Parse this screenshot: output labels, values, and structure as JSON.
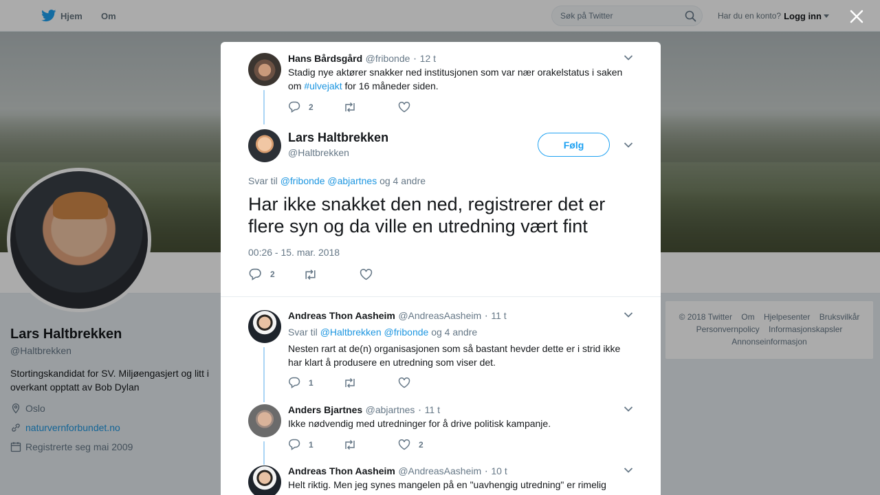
{
  "topbar": {
    "home_label": "Hjem",
    "about_label": "Om",
    "search_placeholder": "Søk på Twitter",
    "account_question": "Har du en konto?",
    "login_label": "Logg inn"
  },
  "profile": {
    "name": "Lars Haltbrekken",
    "handle": "@Haltbrekken",
    "bio": "Stortingskandidat for SV. Miljøengasjert og litt i overkant opptatt av Bob Dylan",
    "location": "Oslo",
    "website": "naturvernforbundet.no",
    "joined": "Registrerte seg mai 2009"
  },
  "footer": {
    "items": [
      "© 2018 Twitter",
      "Om",
      "Hjelpesenter",
      "Bruksvilkår",
      "Personvernpolicy",
      "Informasjonskapsler",
      "Annonseinformasjon"
    ]
  },
  "modal": {
    "parent_tweet": {
      "name": "Hans Bårdsgård",
      "handle": "@fribonde",
      "time": "12 t",
      "text_before": "Stadig nye aktører snakker ned institusjonen som var nær orakelstatus i saken om ",
      "hashtag": "#ulvejakt",
      "text_after": " for 16 måneder siden.",
      "replies": "2"
    },
    "main_tweet": {
      "name": "Lars Haltbrekken",
      "handle": "@Haltbrekken",
      "follow_label": "Følg",
      "reply_prefix": "Svar til",
      "reply_mention_1": "@fribonde",
      "reply_mention_2": "@abjartnes",
      "reply_suffix": "og 4 andre",
      "text": "Har ikke snakket den ned, registrerer det er flere syn og da ville en utredning vært fint",
      "timestamp": "00:26 - 15. mar. 2018",
      "replies": "2"
    },
    "replies": [
      {
        "name": "Andreas Thon Aasheim",
        "handle": "@AndreasAasheim",
        "time": "11 t",
        "reply_prefix": "Svar til",
        "reply_mention_1": "@Haltbrekken",
        "reply_mention_2": "@fribonde",
        "reply_suffix": "og 4 andre",
        "text": "Nesten rart at de(n) organisasjonen som så bastant hevder dette er i strid ikke har klart å produsere en utredning som viser det.",
        "replies": "1"
      },
      {
        "name": "Anders Bjartnes",
        "handle": "@abjartnes",
        "time": "11 t",
        "text": "Ikke nødvendig med utredninger for å drive politisk kampanje.",
        "replies": "1",
        "likes": "2"
      },
      {
        "name": "Andreas Thon Aasheim",
        "handle": "@AndreasAasheim",
        "time": "10 t",
        "text": "Helt riktig. Men jeg synes mangelen på en \"uavhengig utredning\" er rimelig"
      }
    ]
  },
  "colors": {
    "twitter_blue": "#1da1f2",
    "link_blue": "#1b95e0",
    "thread_line": "#aad5f4",
    "muted_text": "#657786"
  }
}
